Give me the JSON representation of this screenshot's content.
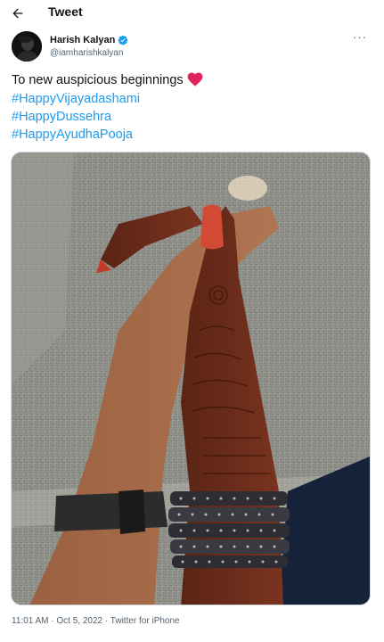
{
  "header": {
    "back_icon": "arrow-left-icon",
    "title": "Tweet"
  },
  "author": {
    "name": "Harish Kalyan",
    "handle": "@iamharishkalyan",
    "verified_icon": "verified-badge-icon",
    "more_icon": "more-dots-icon",
    "more_label": "···"
  },
  "tweet": {
    "line1": "To new auspicious beginnings",
    "heart": "❤️",
    "hashtags": [
      "#HappyVijayadashami",
      "#HappyDussehra",
      "#HappyAyudhaPooja"
    ]
  },
  "media": {
    "description_icon": "photo-holding-hands"
  },
  "meta": {
    "timestamp": "11:01 AM · Oct 5, 2022 · Twitter for iPhone"
  },
  "colors": {
    "accent": "#1d9bf0",
    "text": "#0f1419",
    "secondary": "#536471",
    "heart": "#e0245e"
  }
}
